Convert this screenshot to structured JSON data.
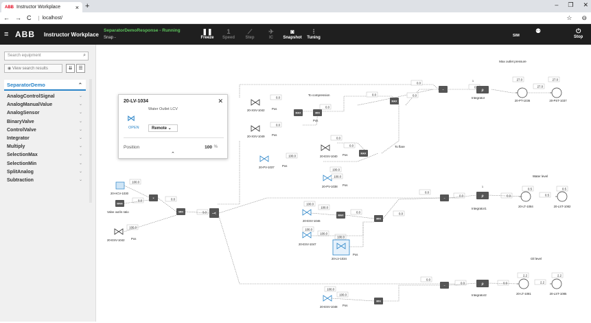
{
  "browser": {
    "tab_logo": "ABB",
    "tab_title": "Instructor Workplace",
    "tab_close": "×",
    "new_tab": "+",
    "back": "←",
    "forward": "→",
    "reload": "C",
    "url": "localhost/",
    "win_min": "–",
    "win_max": "❐",
    "win_close": "✕",
    "star": "☆",
    "profile": "⊖"
  },
  "app": {
    "menu_icon": "≡",
    "logo": "ABB",
    "name": "Instructor Workplace",
    "scenario": "SeparatorDemoResponse - Running",
    "snap": "Snap -",
    "toolbar": [
      {
        "name": "freeze",
        "icon": "❚❚",
        "label": "Freeze",
        "enabled": true
      },
      {
        "name": "speed",
        "icon": "1",
        "label": "Speed",
        "enabled": false
      },
      {
        "name": "step",
        "icon": "⟋",
        "label": "Step",
        "enabled": false
      },
      {
        "name": "ic",
        "icon": "✈",
        "label": "IC",
        "enabled": false
      },
      {
        "name": "snapshot",
        "icon": "◙",
        "label": "Snapshot",
        "enabled": true
      },
      {
        "name": "tuning",
        "icon": "⫶",
        "label": "Tuning",
        "enabled": true
      }
    ],
    "sim_label": "SIM",
    "user_icon": "⚉",
    "stop_icon": "⏻",
    "stop_label": "Stop"
  },
  "sidebar": {
    "search_placeholder": "Search equipment",
    "search_icon": "⌕",
    "view_results": "◉ View search results",
    "view_btn1": "⇊",
    "view_btn2": "☰",
    "group": "SeparatorDemo",
    "group_chev": "⌃",
    "item_chev": "⌄",
    "types": [
      "AnalogControlSignal",
      "AnalogManualValue",
      "AnalogSensor",
      "BinaryValve",
      "ControlValve",
      "Integrator",
      "Multiply",
      "SelectionMax",
      "SelectionMin",
      "SplitAnalog",
      "Subtraction"
    ]
  },
  "popup": {
    "title": "20-LV-1034",
    "close": "✕",
    "desc": "Water Outlet LCV",
    "state": "OPEN",
    "mode": "Remote ⌄",
    "pos_label": "Position",
    "pos_value": "100",
    "pos_unit": "%",
    "expand": "⌃"
  },
  "diagram": {
    "labels": {
      "to_compression": "To compression",
      "to_flare": "To flare",
      "max_outlet": "Max outlet pressure",
      "water_level": "Water level",
      "oil_level": "Oil level",
      "valve_ratio": "Valve out/in ratio",
      "pos": "Pos"
    },
    "tags": {
      "xsv1042": "20-XSV-1042",
      "xsv1049": "20-XSV-1049",
      "pv1037": "20-PV-1037",
      "esv1040": "20-ESV-1040",
      "pv1038": "20-PV-1038",
      "hcv1030": "20-HCV-1030",
      "esv1042b": "20-ESV-1042",
      "esv1046": "20-ESV-1046",
      "esv1047": "20-ESV-1047",
      "lv1034": "20-LV-1034",
      "esv1048": "20-ESV-1048",
      "pt1036": "20-PT-1036",
      "pst1037": "20-PST-1037",
      "lt1084": "20-LT-1084",
      "lst1082": "20-LST-1082",
      "lt1081": "20-LT-1081",
      "lst1085": "20-LST-1085",
      "integrator": "Integrator",
      "integrator1": "Integrator1",
      "integrator2": "Integrator2"
    },
    "blocks": {
      "max": "MAX",
      "min": "MIN",
      "man": "MAN",
      "mul": "×",
      "sub": "−",
      "int": "∫∂",
      "split": "–<"
    },
    "values": {
      "v00": "0.0",
      "v1000": "100.0",
      "v270": "27.0",
      "v05": "0.5",
      "v22": "2.2",
      "d1": "1"
    }
  }
}
